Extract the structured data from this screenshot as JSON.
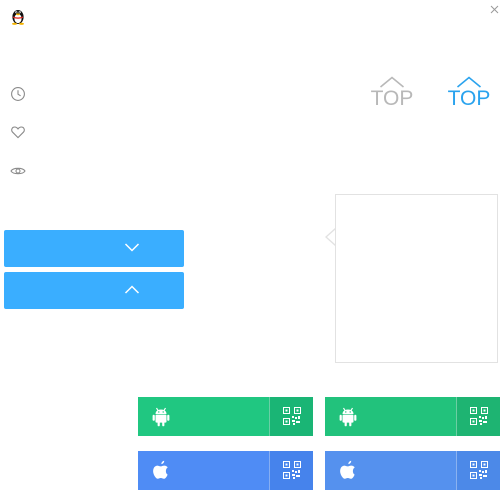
{
  "top_buttons": {
    "inactive_label": "TOP",
    "active_label": "TOP",
    "inactive_color": "#b8b8b8",
    "active_color": "#2aa3ee"
  },
  "sidebar": {
    "icons": [
      "clock-icon",
      "heart-icon",
      "eye-icon"
    ]
  },
  "collapse_bars": {
    "color": "#3aaeff",
    "items": [
      "chevron-down-icon",
      "chevron-up-icon"
    ]
  },
  "app_buttons": {
    "android_color": "#20c781",
    "ios_color": "#4f8cf5",
    "items": [
      "android-icon",
      "apple-icon",
      "qr-code-icon"
    ]
  }
}
